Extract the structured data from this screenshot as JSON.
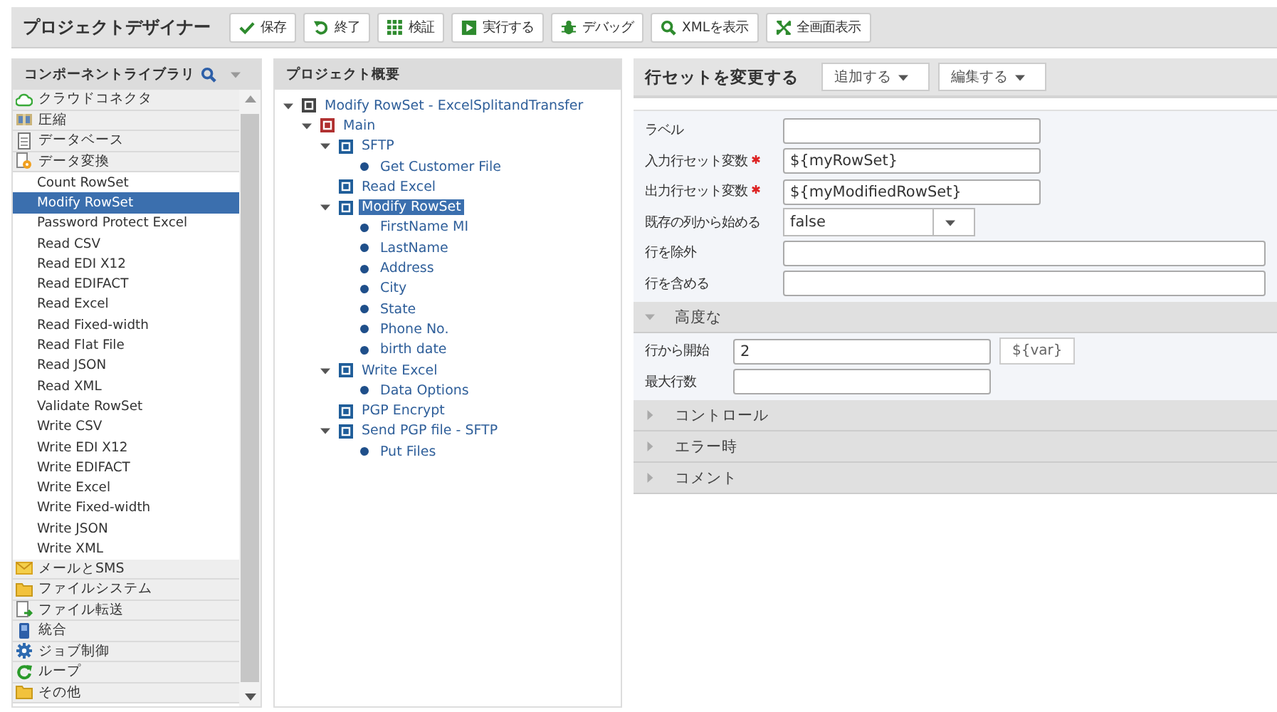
{
  "toolbar": {
    "title": "プロジェクトデザイナー",
    "buttons": [
      {
        "kind": "save",
        "label": "保存"
      },
      {
        "kind": "close",
        "label": "終了"
      },
      {
        "kind": "validate",
        "label": "検証"
      },
      {
        "kind": "run",
        "label": "実行する"
      },
      {
        "kind": "debug",
        "label": "デバッグ"
      },
      {
        "kind": "xml",
        "label": "XMLを表示"
      },
      {
        "kind": "fullscreen",
        "label": "全画面表示"
      }
    ]
  },
  "library": {
    "title": "コンポーネントライブラリ",
    "categories": [
      {
        "kind": "cloud",
        "label": "クラウドコネクタ"
      },
      {
        "kind": "archive",
        "label": "圧縮"
      },
      {
        "kind": "database",
        "label": "データベース"
      },
      {
        "kind": "transform",
        "label": "データ変換",
        "items": [
          {
            "label": "Count RowSet",
            "selected": false
          },
          {
            "label": "Modify RowSet",
            "selected": true
          },
          {
            "label": "Password Protect Excel",
            "selected": false
          },
          {
            "label": "Read CSV",
            "selected": false
          },
          {
            "label": "Read EDI X12",
            "selected": false
          },
          {
            "label": "Read EDIFACT",
            "selected": false
          },
          {
            "label": "Read Excel",
            "selected": false
          },
          {
            "label": "Read Fixed-width",
            "selected": false
          },
          {
            "label": "Read Flat File",
            "selected": false
          },
          {
            "label": "Read JSON",
            "selected": false
          },
          {
            "label": "Read XML",
            "selected": false
          },
          {
            "label": "Validate RowSet",
            "selected": false
          },
          {
            "label": "Write CSV",
            "selected": false
          },
          {
            "label": "Write EDI X12",
            "selected": false
          },
          {
            "label": "Write EDIFACT",
            "selected": false
          },
          {
            "label": "Write Excel",
            "selected": false
          },
          {
            "label": "Write Fixed-width",
            "selected": false
          },
          {
            "label": "Write JSON",
            "selected": false
          },
          {
            "label": "Write XML",
            "selected": false
          }
        ]
      },
      {
        "kind": "mail",
        "label": "メールとSMS"
      },
      {
        "kind": "folder",
        "label": "ファイルシステム"
      },
      {
        "kind": "transfer",
        "label": "ファイル転送"
      },
      {
        "kind": "integration",
        "label": "統合"
      },
      {
        "kind": "gear",
        "label": "ジョブ制御"
      },
      {
        "kind": "loop",
        "label": "ループ"
      },
      {
        "kind": "folder",
        "label": "その他"
      }
    ]
  },
  "outline": {
    "title": "プロジェクト概要",
    "nodes": [
      {
        "kind": "project",
        "label": "Modify RowSet - ExcelSplitandTransfer",
        "expanded": true,
        "selected": false,
        "children": [
          {
            "kind": "module",
            "label": "Main",
            "expanded": true,
            "selected": false,
            "children": [
              {
                "kind": "task",
                "label": "SFTP",
                "expanded": true,
                "selected": false,
                "children": [
                  {
                    "kind": "element",
                    "label": "Get Customer File",
                    "selected": false
                  }
                ]
              },
              {
                "kind": "task",
                "label": "Read Excel",
                "selected": false
              },
              {
                "kind": "task",
                "label": "Modify RowSet",
                "expanded": true,
                "selected": true,
                "children": [
                  {
                    "kind": "element",
                    "label": "FirstName MI",
                    "selected": false
                  },
                  {
                    "kind": "element",
                    "label": "LastName",
                    "selected": false
                  },
                  {
                    "kind": "element",
                    "label": "Address",
                    "selected": false
                  },
                  {
                    "kind": "element",
                    "label": "City",
                    "selected": false
                  },
                  {
                    "kind": "element",
                    "label": "State",
                    "selected": false
                  },
                  {
                    "kind": "element",
                    "label": "Phone No.",
                    "selected": false
                  },
                  {
                    "kind": "element",
                    "label": "birth date",
                    "selected": false
                  }
                ]
              },
              {
                "kind": "task",
                "label": "Write Excel",
                "expanded": true,
                "selected": false,
                "children": [
                  {
                    "kind": "element",
                    "label": "Data Options",
                    "selected": false
                  }
                ]
              },
              {
                "kind": "task",
                "label": "PGP Encrypt",
                "selected": false
              },
              {
                "kind": "task",
                "label": "Send PGP file - SFTP",
                "expanded": true,
                "selected": false,
                "children": [
                  {
                    "kind": "element",
                    "label": "Put Files",
                    "selected": false
                  }
                ]
              }
            ]
          }
        ]
      }
    ]
  },
  "editor": {
    "title": "行セットを変更する",
    "menus": [
      {
        "label": "追加する"
      },
      {
        "label": "編集する"
      }
    ],
    "fields": [
      {
        "kind": "text",
        "label": "ラベル",
        "required": false
      },
      {
        "kind": "text",
        "label": "入力行セット変数",
        "required": true,
        "value": "${myRowSet}"
      },
      {
        "kind": "text",
        "label": "出力行セット変数",
        "required": true,
        "value": "${myModifiedRowSet}"
      },
      {
        "kind": "select",
        "label": "既存の列から始める",
        "required": false,
        "value": "false"
      },
      {
        "kind": "wide",
        "label": "行を除外",
        "required": false
      },
      {
        "kind": "wide",
        "label": "行を含める",
        "required": false
      }
    ],
    "sections": [
      {
        "label": "高度な",
        "expanded": true,
        "fields": [
          {
            "kind": "text",
            "label": "行から開始",
            "required": false,
            "value": "2",
            "button": "${var}"
          },
          {
            "kind": "text",
            "label": "最大行数",
            "required": false
          }
        ]
      },
      {
        "label": "コントロール",
        "expanded": false
      },
      {
        "label": "エラー時",
        "expanded": false
      },
      {
        "label": "コメント",
        "expanded": false
      }
    ]
  }
}
